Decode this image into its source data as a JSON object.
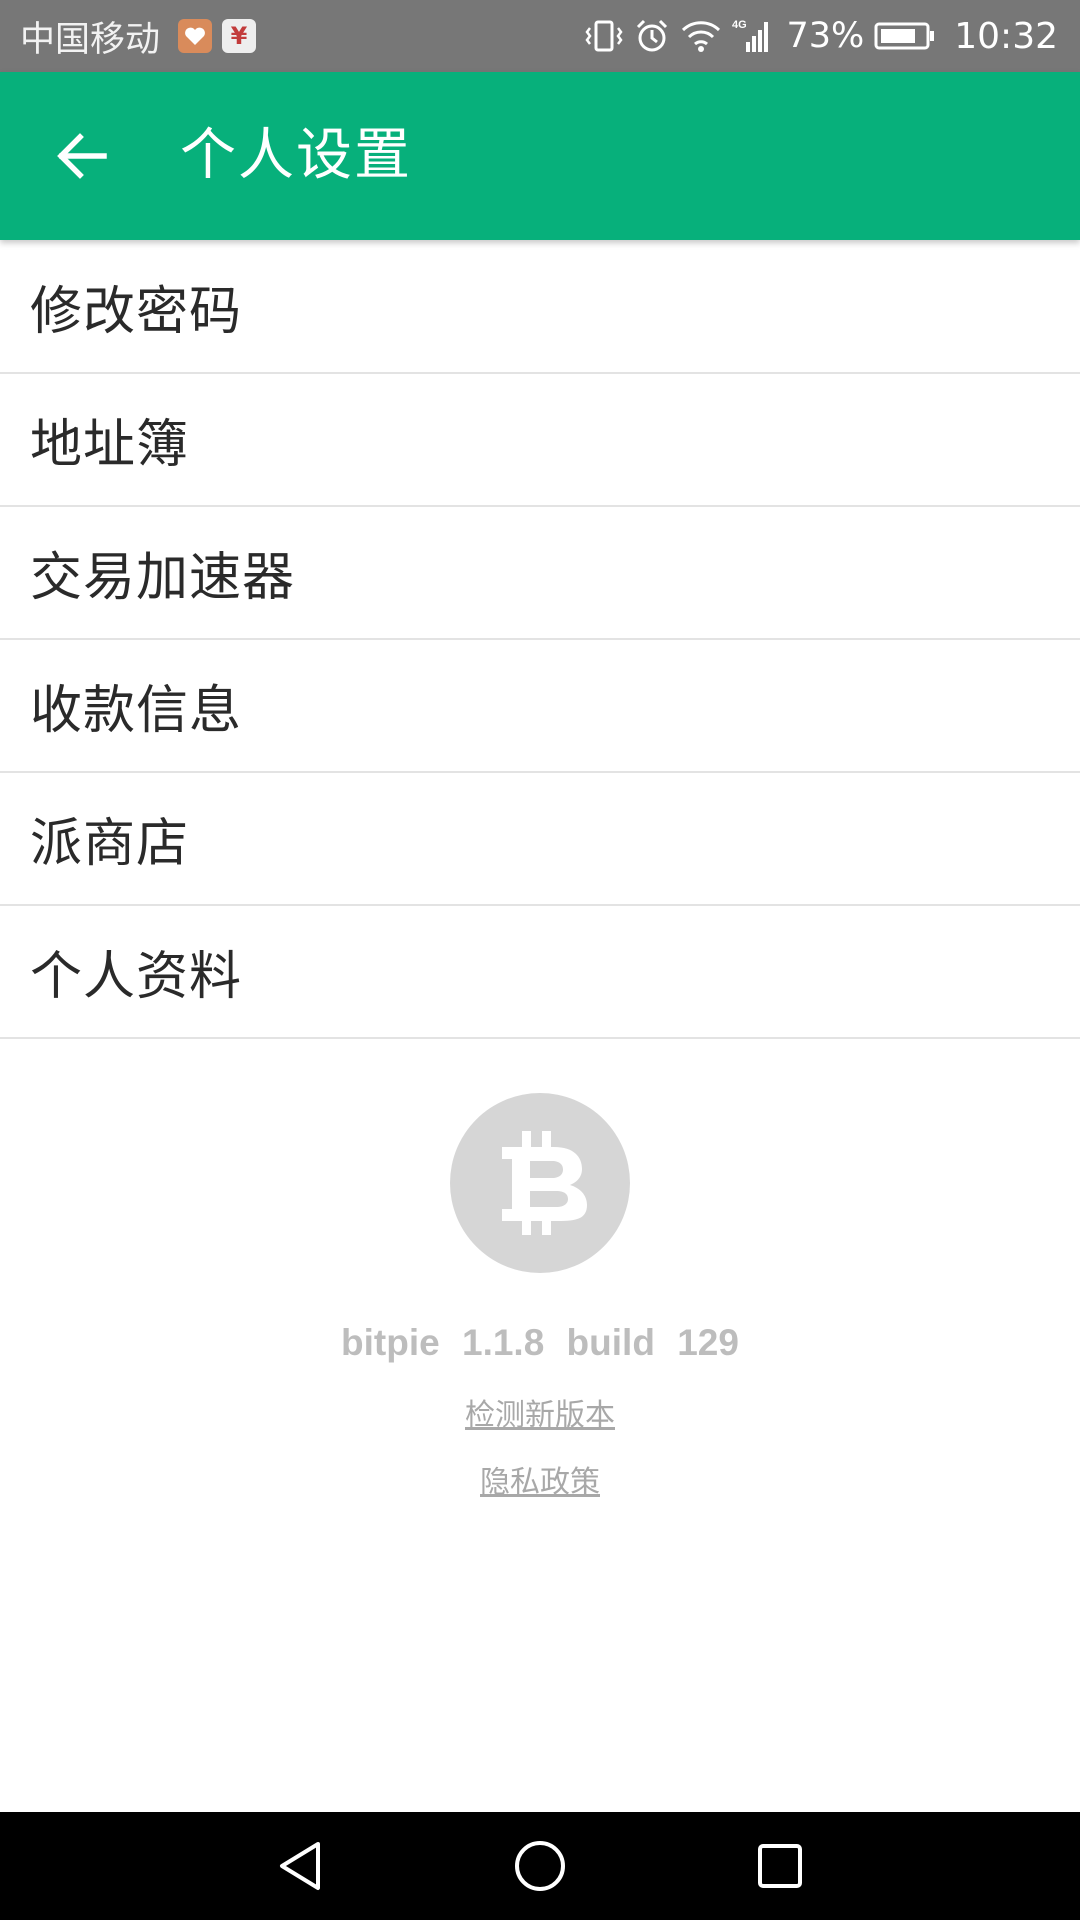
{
  "status_bar": {
    "carrier": "中国移动",
    "notif_yuan_glyph": "¥",
    "battery_percent": "73%",
    "network_type": "4G",
    "time": "10:32",
    "icons": [
      "health-app-icon",
      "yuan-app-icon",
      "vibrate-icon",
      "alarm-icon",
      "wifi-icon",
      "signal-icon",
      "battery-icon"
    ]
  },
  "app_bar": {
    "title": "个人设置",
    "back_icon": "arrow-left-icon",
    "color": "#07b07b"
  },
  "menu": {
    "items": [
      {
        "id": "change-password",
        "label": "修改密码"
      },
      {
        "id": "address-book",
        "label": "地址簿"
      },
      {
        "id": "tx-accelerator",
        "label": "交易加速器"
      },
      {
        "id": "payment-info",
        "label": "收款信息"
      },
      {
        "id": "pie-store",
        "label": "派商店"
      },
      {
        "id": "profile",
        "label": "个人资料"
      }
    ]
  },
  "footer": {
    "logo_icon": "bitcoin-icon",
    "version_text": "bitpie 1.1.8 build 129",
    "check_update_label": "检测新版本",
    "privacy_label": "隐私政策"
  },
  "nav_bar": {
    "buttons": [
      "back-triangle-icon",
      "home-circle-icon",
      "recent-square-icon"
    ]
  }
}
